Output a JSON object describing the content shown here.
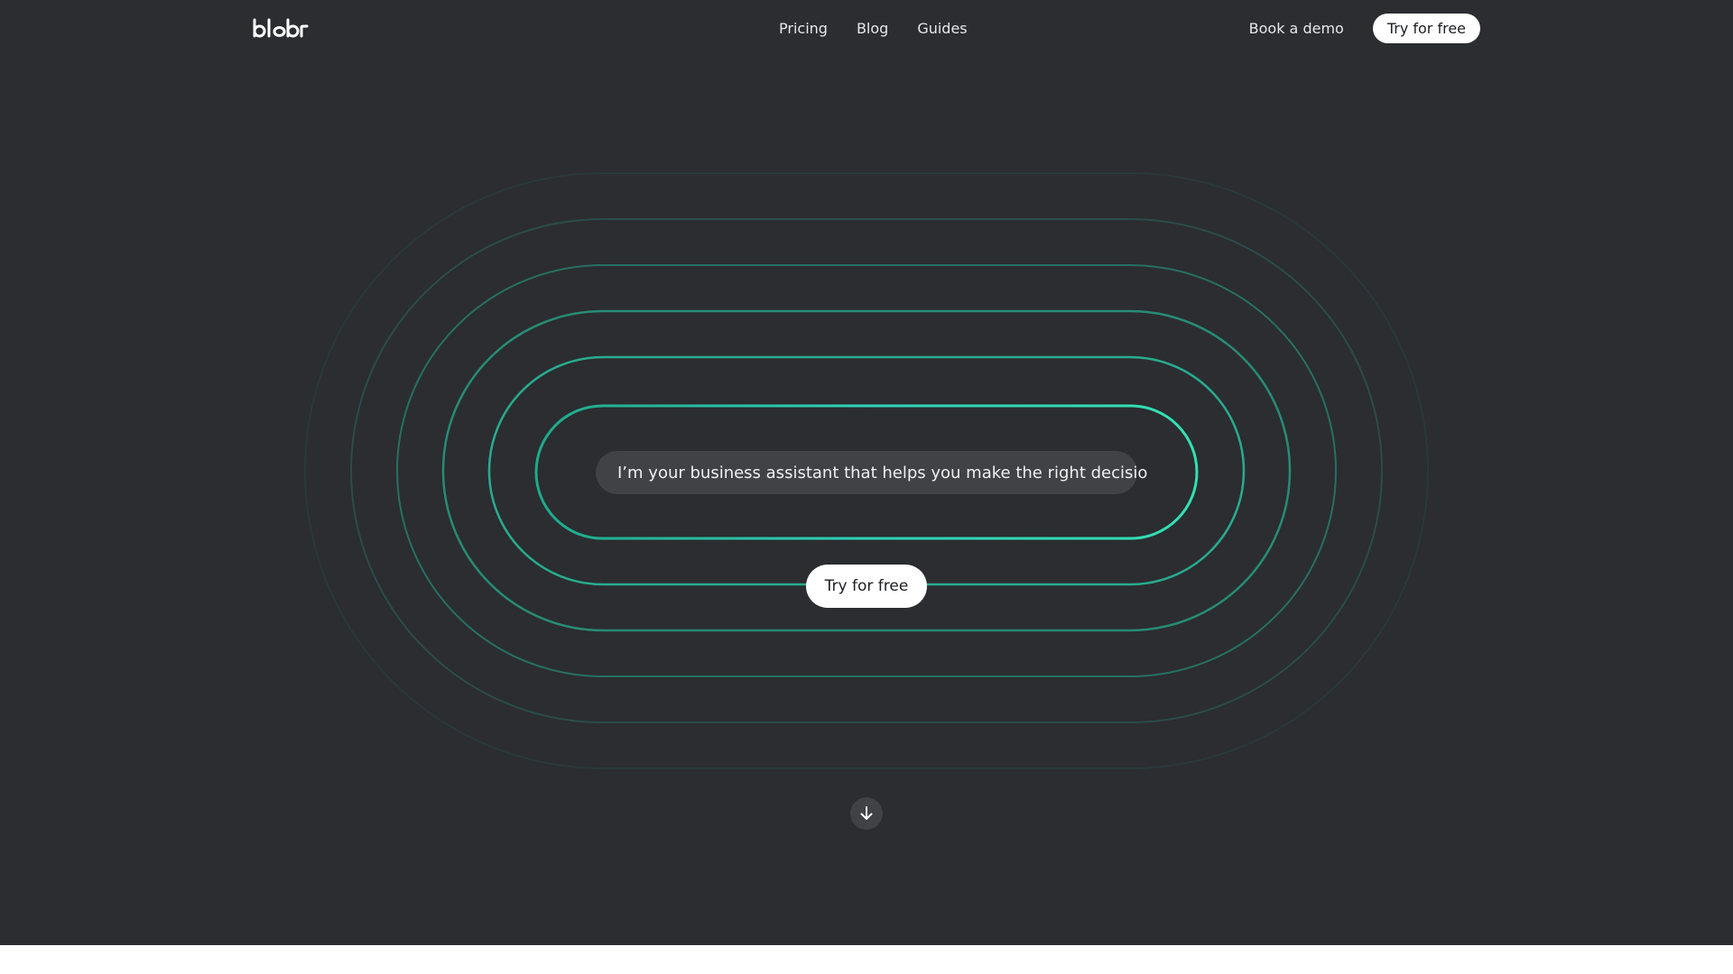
{
  "header": {
    "logo_text": "blobr",
    "nav": [
      {
        "label": "Pricing"
      },
      {
        "label": "Blog"
      },
      {
        "label": "Guides"
      }
    ],
    "demo_label": "Book a demo",
    "cta_label": "Try for free"
  },
  "hero": {
    "prompt_text": "I’m your business assistant that helps you make the right decisio",
    "cta_label": "Try for free",
    "scroll_icon": "arrow-down-icon"
  },
  "colors": {
    "background": "#2b2d31",
    "ring_accent": "#2fd4b0",
    "pill_bg": "#404246",
    "button_bg": "#ffffff"
  }
}
